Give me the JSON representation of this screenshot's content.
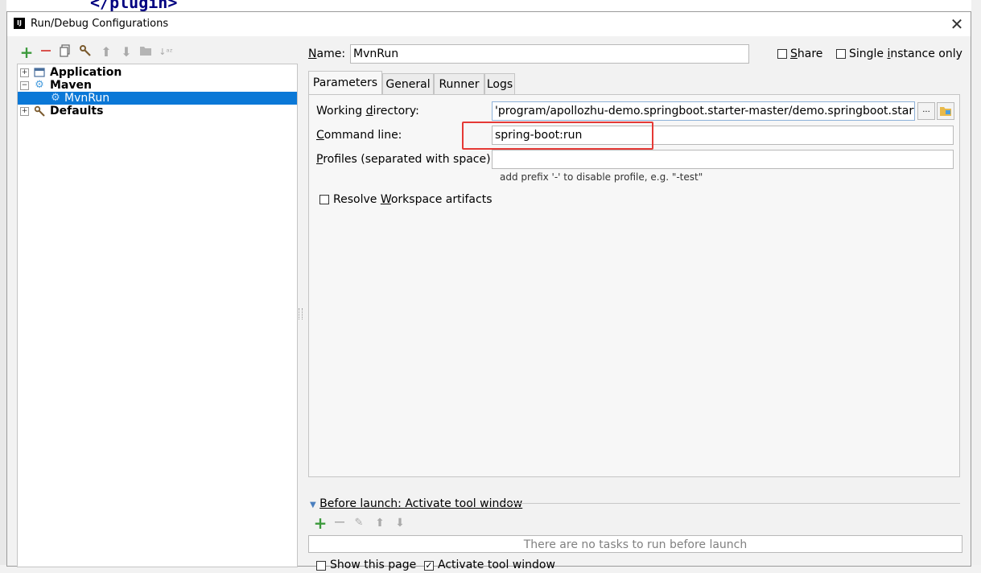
{
  "background": {
    "code_text": "</plugin>"
  },
  "dialog": {
    "title": "Run/Debug Configurations",
    "app_logo_text": "IJ",
    "close_glyph": "✕"
  },
  "toolbar": {
    "icons": [
      "add-icon",
      "remove-icon",
      "copy-icon",
      "edit-defaults-icon",
      "move-up-icon",
      "move-down-icon",
      "folder-icon",
      "sort-icon"
    ]
  },
  "tree": {
    "items": [
      {
        "label": "Application",
        "bold": true,
        "level": 0,
        "expanded": false
      },
      {
        "label": "Maven",
        "bold": true,
        "level": 0,
        "expanded": true
      },
      {
        "label": "MvnRun",
        "bold": false,
        "level": 1,
        "selected": true
      },
      {
        "label": "Defaults",
        "bold": true,
        "level": 0,
        "expanded": false
      }
    ]
  },
  "name_field": {
    "label": "Name:",
    "value": "MvnRun"
  },
  "share": {
    "label": "Share",
    "checked": false
  },
  "single_instance": {
    "label": "Single instance only",
    "checked": false
  },
  "tabs": [
    "Parameters",
    "General",
    "Runner",
    "Logs"
  ],
  "active_tab": "Parameters",
  "parameters": {
    "working_directory_label": "Working directory:",
    "working_directory_value": "'program/apollozhu-demo.springboot.starter-master/demo.springboot.starter",
    "browse_label": "...",
    "command_line_label": "Command line:",
    "command_line_value": "spring-boot:run",
    "profiles_label": "Profiles (separated with space):",
    "profiles_value": "",
    "profiles_hint": "add prefix '-' to disable profile, e.g. \"-test\"",
    "resolve_workspace_label": "Resolve Workspace artifacts",
    "resolve_workspace_checked": false
  },
  "before_launch": {
    "title": "Before launch: Activate tool window",
    "empty_text": "There are no tasks to run before launch",
    "show_this_page_label": "Show this page",
    "show_this_page_checked": false,
    "activate_tool_window_label": "Activate tool window",
    "activate_tool_window_checked": true
  },
  "colors": {
    "selection": "#0a78d7",
    "highlight_box": "#e53935",
    "add_green": "#3c9a3c",
    "remove_red": "#d9534f"
  }
}
